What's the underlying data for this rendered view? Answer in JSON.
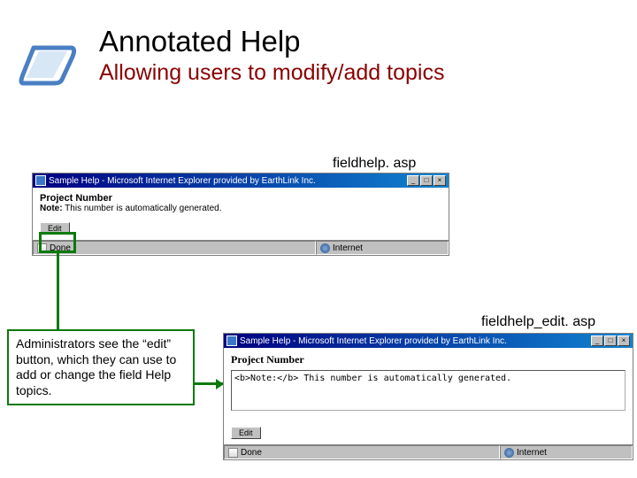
{
  "header": {
    "title": "Annotated Help",
    "subtitle": "Allowing users to modify/add topics"
  },
  "labels": {
    "file1": "fieldhelp. asp",
    "file2": "fieldhelp_edit. asp"
  },
  "win1": {
    "title": "Sample Help - Microsoft Internet Explorer provided by EarthLink Inc.",
    "heading": "Project Number",
    "note_label": "Note:",
    "note_text": "This number is automatically generated.",
    "edit_btn": "Edit",
    "status_left": "Done",
    "status_right": "Internet",
    "btn_min": "_",
    "btn_max": "□",
    "btn_close": "×"
  },
  "win2": {
    "title": "Sample Help - Microsoft Internet Explorer provided by EarthLink Inc.",
    "heading": "Project Number",
    "textarea": "<b>Note:</b> This number is automatically generated.",
    "edit_btn": "Edit",
    "status_left": "Done",
    "status_right": "Internet",
    "btn_min": "_",
    "btn_max": "□",
    "btn_close": "×"
  },
  "callout": {
    "text": "Administrators see the “edit” button, which they can use to add or change the field Help topics."
  }
}
